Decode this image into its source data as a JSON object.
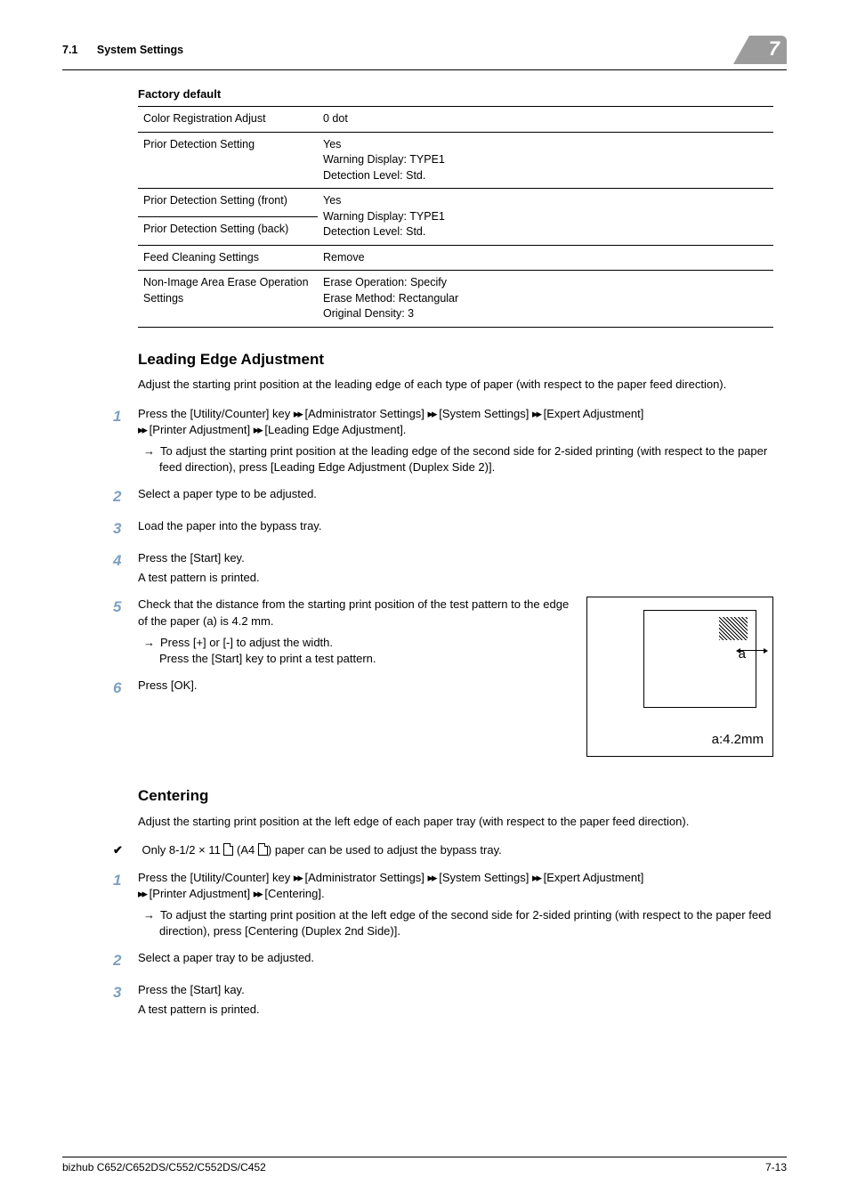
{
  "header": {
    "section_number": "7.1",
    "section_title": "System Settings",
    "chapter_number": "7"
  },
  "table": {
    "title": "Factory default",
    "rows": [
      {
        "c1": "Color Registration Adjust",
        "c2": "0 dot"
      },
      {
        "c1": "Prior Detection Setting",
        "c2": "Yes\nWarning Display: TYPE1\nDetection Level: Std."
      },
      {
        "c1": "Prior Detection Setting (front)",
        "c2": "Yes\nWarning Display: TYPE1\nDetection Level: Std."
      },
      {
        "c1": "Prior Detection Setting (back)",
        "c2": ""
      },
      {
        "c1": "Feed Cleaning Settings",
        "c2": "Remove"
      },
      {
        "c1": "Non-Image Area Erase Operation Settings",
        "c2": "Erase Operation: Specify\nErase Method: Rectangular\nOriginal Density: 3"
      }
    ]
  },
  "section_leading": {
    "heading": "Leading Edge Adjustment",
    "intro": "Adjust the starting print position at the leading edge of each type of paper (with respect to the paper feed direction).",
    "step1_a": "Press the [Utility/Counter] key ",
    "step1_b": " [Administrator Settings] ",
    "step1_c": " [System Settings] ",
    "step1_d": " [Expert Adjustment] ",
    "step1_e": " [Printer Adjustment] ",
    "step1_f": " [Leading Edge Adjustment].",
    "step1_sub": "To adjust the starting print position at the leading edge of the second side for 2-sided printing (with respect to the paper feed direction), press [Leading Edge Adjustment (Duplex Side 2)].",
    "step2": "Select a paper type to be adjusted.",
    "step3": "Load the paper into the bypass tray.",
    "step4": "Press the [Start] key.",
    "step4_result": "A test pattern is printed.",
    "step5": "Check that the distance from the starting print position of the test pattern to the edge of the paper (a) is 4.2 mm.",
    "step5_sub": "Press [+] or [-] to adjust the width.\nPress the [Start] key to print a test pattern.",
    "step6": "Press [OK].",
    "diagram_a": "a",
    "diagram_caption": "a:4.2mm"
  },
  "section_centering": {
    "heading": "Centering",
    "intro": "Adjust the starting print position at the left edge of each paper tray (with respect to the paper feed direction).",
    "check_a": "Only 8-1/2 × 11 ",
    "check_b": " (A4 ",
    "check_c": ") paper can be used to adjust the bypass tray.",
    "step1_a": "Press the [Utility/Counter] key ",
    "step1_b": " [Administrator Settings] ",
    "step1_c": " [System Settings] ",
    "step1_d": " [Expert Adjustment] ",
    "step1_e": " [Printer Adjustment] ",
    "step1_f": " [Centering].",
    "step1_sub": "To adjust the starting print position at the left edge of the second side for 2-sided printing (with respect to the paper feed direction), press [Centering (Duplex 2nd Side)].",
    "step2": "Select a paper tray to be adjusted.",
    "step3": "Press the [Start] kay.",
    "step3_result": "A test pattern is printed."
  },
  "footer": {
    "left": "bizhub C652/C652DS/C552/C552DS/C452",
    "right": "7-13"
  },
  "nums": {
    "n1": "1",
    "n2": "2",
    "n3": "3",
    "n4": "4",
    "n5": "5",
    "n6": "6"
  }
}
